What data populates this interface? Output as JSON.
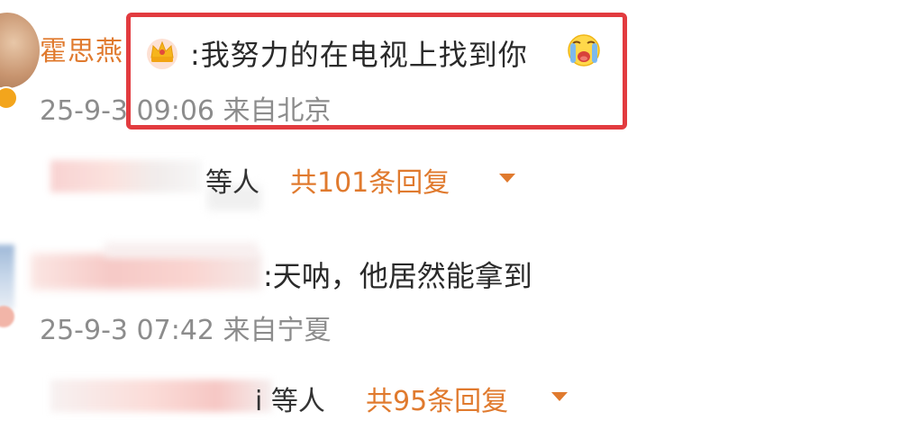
{
  "comments": [
    {
      "username": "霍思燕",
      "emoji_before": "crown-emoji",
      "text": ":我努力的在电视上找到你",
      "emoji_after": "crying-face-emoji",
      "meta": "25-9-3 09:06 来自北京",
      "replies": {
        "names_suffix": "等人",
        "count_label": "共101条回复"
      }
    },
    {
      "text": ":天呐，他居然能拿到",
      "meta": "25-9-3 07:42 来自宁夏",
      "replies": {
        "names_suffix": "i 等人",
        "count_label": "共95条回复"
      }
    }
  ],
  "colors": {
    "accent": "#e07a2e",
    "highlight_border": "#e23b3f",
    "meta_text": "#8c8c8c",
    "body_text": "#2a2a2a"
  }
}
